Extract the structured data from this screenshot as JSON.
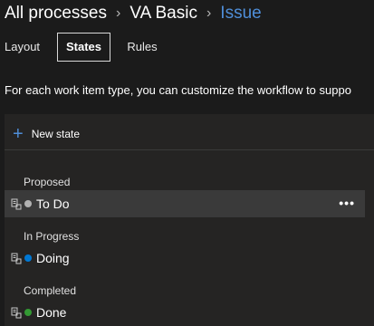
{
  "breadcrumb": {
    "items": [
      "All processes",
      "VA Basic"
    ],
    "current": "Issue",
    "separator": "›"
  },
  "tabs": [
    {
      "label": "Layout",
      "selected": false
    },
    {
      "label": "States",
      "selected": true
    },
    {
      "label": "Rules",
      "selected": false
    }
  ],
  "description": "For each work item type, you can customize the workflow to suppo",
  "toolbar": {
    "new_state_icon": "plus-icon",
    "new_state_label": "New state"
  },
  "groups": [
    {
      "label": "Proposed",
      "states": [
        {
          "name": "To Do",
          "color": "#b2b2b2",
          "selected": true
        }
      ]
    },
    {
      "label": "In Progress",
      "states": [
        {
          "name": "Doing",
          "color": "#0078d4",
          "selected": false
        }
      ]
    },
    {
      "label": "Completed",
      "states": [
        {
          "name": "Done",
          "color": "#339933",
          "selected": false
        }
      ]
    }
  ],
  "colors": {
    "accent": "#4f8ed8",
    "background": "#1b1b1b",
    "panel": "#252423",
    "selected_row": "#3a3a3a"
  },
  "row_more_icon": "more-horizontal-icon"
}
